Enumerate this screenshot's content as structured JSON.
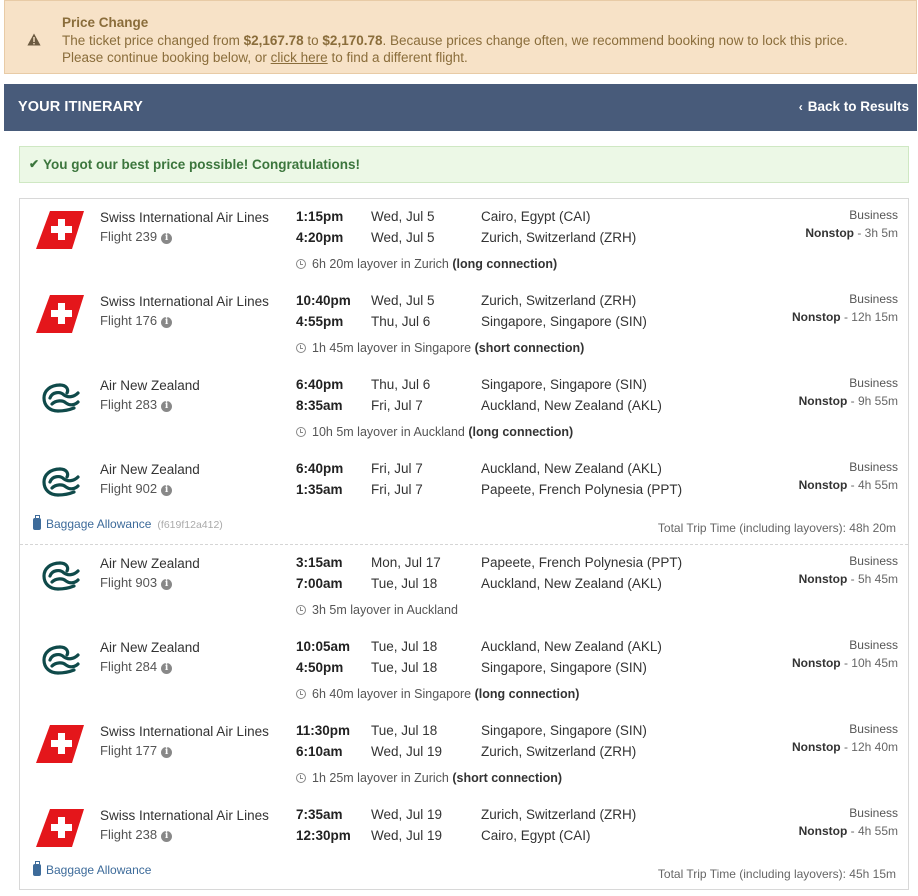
{
  "alert": {
    "title": "Price Change",
    "line1_pre": "The ticket price changed from ",
    "old_price": "$2,167.78",
    "line1_mid": " to ",
    "new_price": "$2,170.78",
    "line1_post": ". Because prices change often, we recommend booking now to lock this price.",
    "line2_pre": "Please continue booking below, or ",
    "link_text": "click here",
    "line2_post": " to find a different flight."
  },
  "header": {
    "title": "YOUR ITINERARY",
    "back_label": "Back to Results"
  },
  "success": {
    "text": "You got our best price possible! Congratulations!"
  },
  "legs": [
    {
      "segments": [
        {
          "airline": "Swiss International Air Lines",
          "logo": "swiss",
          "flight": "Flight 239",
          "dep_time": "1:15pm",
          "arr_time": "4:20pm",
          "dep_date": "Wed, Jul 5",
          "arr_date": "Wed, Jul 5",
          "dep_place": "Cairo, Egypt (CAI)",
          "arr_place": "Zurich, Switzerland (ZRH)",
          "cabin": "Business",
          "stops": "Nonstop",
          "duration": " - 3h 5m",
          "layover_text": "6h 20m layover in Zurich ",
          "layover_note": "(long connection)"
        },
        {
          "airline": "Swiss International Air Lines",
          "logo": "swiss",
          "flight": "Flight 176",
          "dep_time": "10:40pm",
          "arr_time": "4:55pm",
          "dep_date": "Wed, Jul 5",
          "arr_date": "Thu, Jul 6",
          "dep_place": "Zurich, Switzerland (ZRH)",
          "arr_place": "Singapore, Singapore (SIN)",
          "cabin": "Business",
          "stops": "Nonstop",
          "duration": " - 12h 15m",
          "layover_text": "1h 45m layover in Singapore ",
          "layover_note": "(short connection)"
        },
        {
          "airline": "Air New Zealand",
          "logo": "anz",
          "flight": "Flight 283",
          "dep_time": "6:40pm",
          "arr_time": "8:35am",
          "dep_date": "Thu, Jul 6",
          "arr_date": "Fri, Jul 7",
          "dep_place": "Singapore, Singapore (SIN)",
          "arr_place": "Auckland, New Zealand (AKL)",
          "cabin": "Business",
          "stops": "Nonstop",
          "duration": " - 9h 55m",
          "layover_text": "10h 5m layover in Auckland ",
          "layover_note": "(long connection)"
        },
        {
          "airline": "Air New Zealand",
          "logo": "anz",
          "flight": "Flight 902",
          "dep_time": "6:40pm",
          "arr_time": "1:35am",
          "dep_date": "Fri, Jul 7",
          "arr_date": "Fri, Jul 7",
          "dep_place": "Auckland, New Zealand (AKL)",
          "arr_place": "Papeete, French Polynesia (PPT)",
          "cabin": "Business",
          "stops": "Nonstop",
          "duration": " - 4h 55m",
          "layover_text": "",
          "layover_note": ""
        }
      ],
      "baggage_label": "Baggage Allowance",
      "baggage_code": "(f619f12a412)",
      "total_time": "Total Trip Time (including layovers): 48h 20m"
    },
    {
      "segments": [
        {
          "airline": "Air New Zealand",
          "logo": "anz",
          "flight": "Flight 903",
          "dep_time": "3:15am",
          "arr_time": "7:00am",
          "dep_date": "Mon, Jul 17",
          "arr_date": "Tue, Jul 18",
          "dep_place": "Papeete, French Polynesia (PPT)",
          "arr_place": "Auckland, New Zealand (AKL)",
          "cabin": "Business",
          "stops": "Nonstop",
          "duration": " - 5h 45m",
          "layover_text": "3h 5m layover in Auckland",
          "layover_note": ""
        },
        {
          "airline": "Air New Zealand",
          "logo": "anz",
          "flight": "Flight 284",
          "dep_time": "10:05am",
          "arr_time": "4:50pm",
          "dep_date": "Tue, Jul 18",
          "arr_date": "Tue, Jul 18",
          "dep_place": "Auckland, New Zealand (AKL)",
          "arr_place": "Singapore, Singapore (SIN)",
          "cabin": "Business",
          "stops": "Nonstop",
          "duration": " - 10h 45m",
          "layover_text": "6h 40m layover in Singapore ",
          "layover_note": "(long connection)"
        },
        {
          "airline": "Swiss International Air Lines",
          "logo": "swiss",
          "flight": "Flight 177",
          "dep_time": "11:30pm",
          "arr_time": "6:10am",
          "dep_date": "Tue, Jul 18",
          "arr_date": "Wed, Jul 19",
          "dep_place": "Singapore, Singapore (SIN)",
          "arr_place": "Zurich, Switzerland (ZRH)",
          "cabin": "Business",
          "stops": "Nonstop",
          "duration": " - 12h 40m",
          "layover_text": "1h 25m layover in Zurich ",
          "layover_note": "(short connection)"
        },
        {
          "airline": "Swiss International Air Lines",
          "logo": "swiss",
          "flight": "Flight 238",
          "dep_time": "7:35am",
          "arr_time": "12:30pm",
          "dep_date": "Wed, Jul 19",
          "arr_date": "Wed, Jul 19",
          "dep_place": "Zurich, Switzerland (ZRH)",
          "arr_place": "Cairo, Egypt (CAI)",
          "cabin": "Business",
          "stops": "Nonstop",
          "duration": " - 4h 55m",
          "layover_text": "",
          "layover_note": ""
        }
      ],
      "baggage_label": "Baggage Allowance",
      "baggage_code": "",
      "total_time": "Total Trip Time (including layovers): 45h 15m"
    }
  ],
  "icons": {
    "warning": "warning-icon",
    "back": "chevron-left-icon",
    "check": "check-icon",
    "info": "info-icon",
    "clock": "clock-icon",
    "baggage": "suitcase-icon"
  },
  "colors": {
    "header_bg": "#485b7a",
    "alert_bg": "#f7e2c7",
    "success_bg": "#ecf8e6",
    "swiss_red": "#e4161b",
    "anz_teal": "#0f4a4a",
    "link_blue": "#3d6b9a"
  }
}
